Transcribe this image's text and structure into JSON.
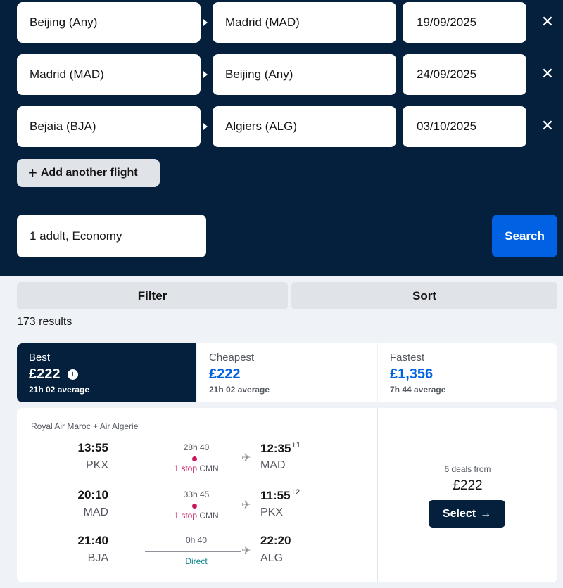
{
  "search": {
    "legs": [
      {
        "from": "Beijing (Any)",
        "to": "Madrid (MAD)",
        "date": "19/09/2025"
      },
      {
        "from": "Madrid (MAD)",
        "to": "Beijing (Any)",
        "date": "24/09/2025"
      },
      {
        "from": "Bejaia (BJA)",
        "to": "Algiers (ALG)",
        "date": "03/10/2025"
      }
    ],
    "remove_icon": "✕",
    "add_flight_plus": "+",
    "add_flight_label": "Add another flight",
    "travellers": "1 adult, Economy",
    "search_label": "Search"
  },
  "controls": {
    "filter_label": "Filter",
    "sort_label": "Sort"
  },
  "results_count": "173 results",
  "tabs": [
    {
      "title": "Best",
      "price": "£222",
      "sub": "21h 02 average"
    },
    {
      "title": "Cheapest",
      "price": "£222",
      "sub": "21h 02 average"
    },
    {
      "title": "Fastest",
      "price": "£1,356",
      "sub": "7h 44 average"
    }
  ],
  "info_icon": "i",
  "result": {
    "airline": "Royal Air Maroc + Air Algerie",
    "legs": [
      {
        "dep_time": "13:55",
        "dep_code": "PKX",
        "duration": "28h 40",
        "stops_count": "1 stop",
        "stop_airport": " CMN",
        "arr_time": "12:35",
        "day_offset": "+1",
        "arr_code": "MAD"
      },
      {
        "dep_time": "20:10",
        "dep_code": "MAD",
        "duration": "33h 45",
        "stops_count": "1 stop",
        "stop_airport": " CMN",
        "arr_time": "11:55",
        "day_offset": "+2",
        "arr_code": "PKX"
      },
      {
        "dep_time": "21:40",
        "dep_code": "BJA",
        "duration": "0h 40",
        "direct_label": "Direct",
        "arr_time": "22:20",
        "arr_code": "ALG"
      }
    ],
    "plane_icon": "✈",
    "deals_text": "6 deals from",
    "price": "£222",
    "select_label": "Select",
    "select_arrow": "→"
  },
  "colors": {
    "navy": "#05203c",
    "blue": "#0062e3",
    "stop_pink": "#c8175d",
    "direct_teal": "#0c838a",
    "background": "#eff3f8"
  }
}
